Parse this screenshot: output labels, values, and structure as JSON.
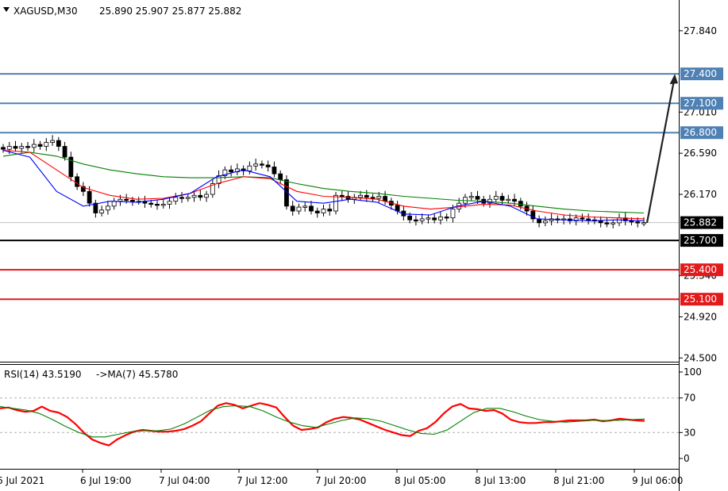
{
  "header": {
    "menu_icon": "triangle-down-icon",
    "symbol": "XAGUSD,M30",
    "ohlc": "25.890 25.907 25.877 25.882"
  },
  "rsi_header": {
    "label": "RSI(14) 43.5190",
    "ma_label": "->MA(7) 45.5780"
  },
  "colors": {
    "blue_line": "#4f81b4",
    "red_line": "#e31a1c",
    "black_line": "#000000",
    "ma_fast": "#0000ff",
    "ma_mid": "#ff0000",
    "ma_slow": "#008000",
    "rsi": "#ff0000",
    "rsi_ma": "#008000"
  },
  "chart_data": [
    {
      "type": "candlestick",
      "symbol": "XAGUSD",
      "timeframe": "M30",
      "ylim": [
        24.4,
        28.1
      ],
      "y_ticks": [
        "27.840",
        "27.010",
        "26.590",
        "26.170",
        "25.340",
        "24.920",
        "24.500"
      ],
      "x_ticks": [
        "6 Jul 2021",
        "6 Jul 19:00",
        "7 Jul 04:00",
        "7 Jul 12:00",
        "7 Jul 20:00",
        "8 Jul 05:00",
        "8 Jul 13:00",
        "8 Jul 21:00",
        "9 Jul 06:00"
      ],
      "current_price": {
        "value": 25.882,
        "label": "25.882"
      },
      "levels": [
        {
          "value": 27.4,
          "label": "27.400",
          "kind": "resistance",
          "color": "blue"
        },
        {
          "value": 27.1,
          "label": "27.100",
          "kind": "resistance",
          "color": "blue"
        },
        {
          "value": 26.8,
          "label": "26.800",
          "kind": "resistance",
          "color": "blue"
        },
        {
          "value": 25.7,
          "label": "25.700",
          "kind": "pivot",
          "color": "black"
        },
        {
          "value": 25.4,
          "label": "25.400",
          "kind": "support",
          "color": "red"
        },
        {
          "value": 25.1,
          "label": "25.100",
          "kind": "support",
          "color": "red"
        }
      ],
      "arrow": {
        "from_price": 25.88,
        "to_price": 27.4,
        "direction": "up"
      },
      "closes": [
        26.63,
        26.66,
        26.64,
        26.66,
        26.65,
        26.68,
        26.66,
        26.7,
        26.72,
        26.66,
        26.55,
        26.35,
        26.25,
        26.2,
        26.08,
        25.98,
        26.01,
        26.05,
        26.1,
        26.12,
        26.11,
        26.1,
        26.1,
        26.08,
        26.07,
        26.06,
        26.07,
        26.1,
        26.14,
        26.13,
        26.14,
        26.16,
        26.14,
        26.17,
        26.28,
        26.36,
        26.42,
        26.4,
        26.43,
        26.41,
        26.46,
        26.48,
        26.47,
        26.45,
        26.38,
        26.32,
        26.05,
        26.0,
        26.04,
        26.05,
        26.0,
        25.98,
        26.02,
        26.0,
        26.16,
        26.15,
        26.12,
        26.14,
        26.16,
        26.14,
        26.13,
        26.15,
        26.1,
        26.06,
        26.0,
        25.95,
        25.91,
        25.9,
        25.92,
        25.93,
        25.91,
        25.94,
        25.93,
        26.02,
        26.08,
        26.14,
        26.15,
        26.12,
        26.08,
        26.12,
        26.15,
        26.11,
        26.12,
        26.1,
        26.05,
        26.0,
        25.92,
        25.88,
        25.9,
        25.92,
        25.91,
        25.92,
        25.9,
        25.93,
        25.92,
        25.91,
        25.9,
        25.88,
        25.87,
        25.88,
        25.93,
        25.9,
        25.89,
        25.88,
        25.882
      ],
      "ma_fast": {
        "name": "MA fast",
        "values": [
          26.62,
          26.55,
          26.2,
          26.05,
          26.1,
          26.09,
          26.12,
          26.18,
          26.35,
          26.42,
          26.35,
          26.1,
          26.08,
          26.12,
          26.09,
          25.97,
          25.96,
          26.05,
          26.1,
          26.05,
          25.92,
          25.91,
          25.9,
          25.91,
          25.9
        ]
      },
      "ma_mid": {
        "name": "MA mid",
        "values": [
          26.62,
          26.6,
          26.42,
          26.24,
          26.16,
          26.12,
          26.13,
          26.18,
          26.28,
          26.35,
          26.33,
          26.2,
          26.15,
          26.14,
          26.12,
          26.05,
          26.02,
          26.04,
          26.07,
          26.06,
          26.0,
          25.96,
          25.94,
          25.93,
          25.92
        ]
      },
      "ma_slow": {
        "name": "MA slow",
        "values": [
          26.56,
          26.6,
          26.56,
          26.48,
          26.42,
          26.38,
          26.35,
          26.34,
          26.34,
          26.35,
          26.34,
          26.28,
          26.23,
          26.2,
          26.18,
          26.15,
          26.13,
          26.11,
          26.1,
          26.08,
          26.05,
          26.02,
          26.0,
          25.99,
          25.98
        ]
      }
    },
    {
      "type": "line",
      "title": "RSI(14) 43.5190 ->MA(7) 45.5780",
      "ylim": [
        0,
        100
      ],
      "y_ticks": [
        "100",
        "70",
        "30",
        "0"
      ],
      "levels": [
        70,
        30
      ],
      "series": [
        {
          "name": "RSI(14)",
          "values": [
            58,
            59,
            56,
            54,
            55,
            60,
            55,
            53,
            48,
            40,
            30,
            22,
            18,
            15,
            22,
            27,
            31,
            33,
            32,
            31,
            31,
            32,
            34,
            38,
            43,
            52,
            61,
            64,
            62,
            58,
            61,
            64,
            62,
            59,
            48,
            38,
            33,
            34,
            36,
            42,
            46,
            48,
            47,
            45,
            41,
            37,
            33,
            30,
            27,
            26,
            32,
            35,
            42,
            52,
            60,
            63,
            58,
            57,
            55,
            56,
            52,
            45,
            42,
            41,
            41,
            42,
            42,
            43,
            44,
            44,
            44,
            45,
            43,
            44,
            46,
            45,
            44,
            43.5
          ]
        },
        {
          "name": "MA(7)",
          "values": [
            60,
            58,
            56,
            52,
            45,
            37,
            30,
            25,
            25,
            28,
            31,
            32,
            32,
            34,
            40,
            48,
            56,
            60,
            61,
            60,
            55,
            48,
            42,
            38,
            36,
            40,
            44,
            47,
            46,
            43,
            38,
            33,
            29,
            28,
            33,
            43,
            53,
            58,
            58,
            54,
            49,
            45,
            43,
            42,
            43,
            44,
            44,
            44,
            45,
            45.6
          ]
        }
      ]
    }
  ]
}
